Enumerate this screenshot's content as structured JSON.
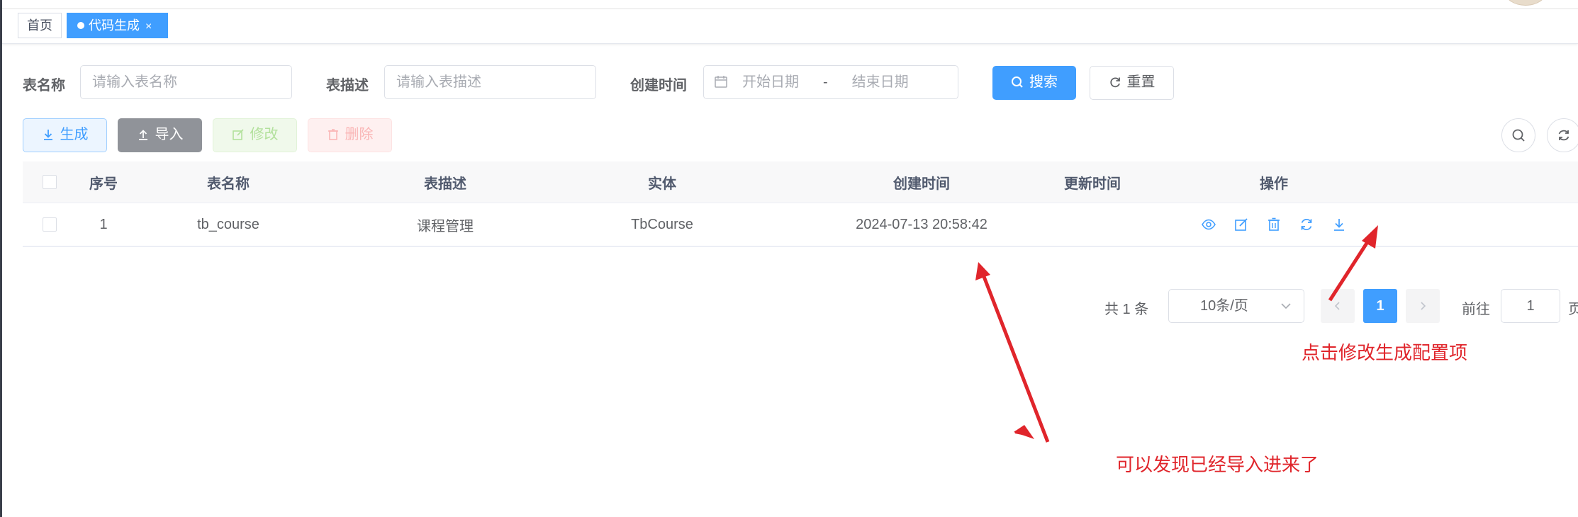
{
  "tags": {
    "home": "首页",
    "active": "代码生成",
    "close": "×"
  },
  "search": {
    "table_name_label": "表名称",
    "table_name_placeholder": "请输入表名称",
    "table_desc_label": "表描述",
    "table_desc_placeholder": "请输入表描述",
    "created_label": "创建时间",
    "start_placeholder": "开始日期",
    "range_separator": "-",
    "end_placeholder": "结束日期",
    "search_button": "搜索",
    "reset_button": "重置"
  },
  "toolbar": {
    "generate": "生成",
    "import": "导入",
    "edit": "修改",
    "delete": "删除"
  },
  "table": {
    "columns": [
      "序号",
      "表名称",
      "表描述",
      "实体",
      "创建时间",
      "更新时间",
      "操作"
    ],
    "rows": [
      {
        "index": "1",
        "table_name": "tb_course",
        "table_desc": "课程管理",
        "entity": "TbCourse",
        "created": "2024-07-13 20:58:42",
        "updated": ""
      }
    ],
    "operations": [
      "preview-icon",
      "edit-icon",
      "delete-icon",
      "sync-icon",
      "download-icon"
    ]
  },
  "pagination": {
    "total": "共 1 条",
    "page_size": "10条/页",
    "current_page": "1",
    "goto_label": "前往",
    "goto_value": "1",
    "goto_suffix": "页"
  },
  "annotations": {
    "edit_hint": "点击修改生成配置项",
    "import_hint": "可以发现已经导入进来了"
  },
  "colors": {
    "primary": "#409eff",
    "annotation": "#e0252b"
  }
}
